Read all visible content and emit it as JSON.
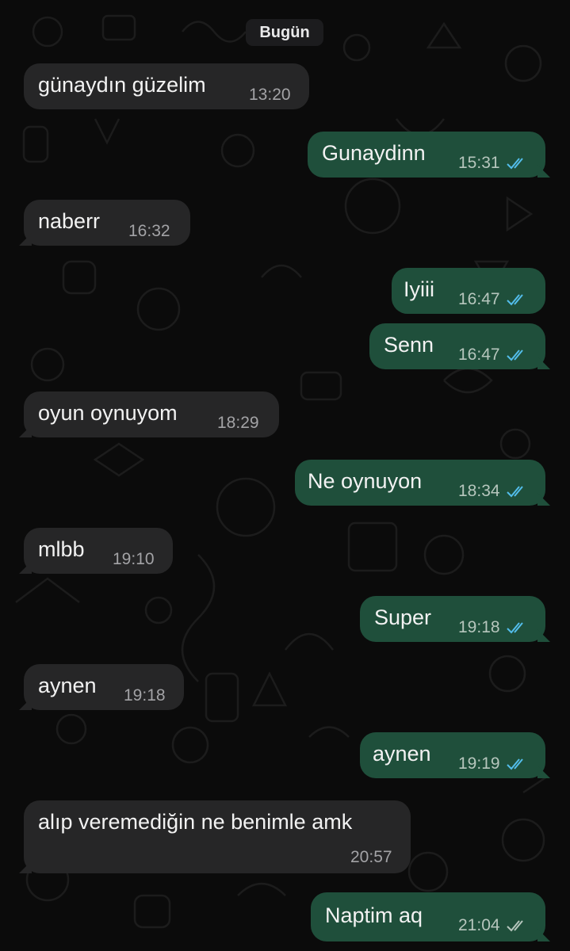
{
  "date_divider": "Bugün",
  "colors": {
    "background": "#0b0b0b",
    "incoming_bubble": "#262627",
    "outgoing_bubble": "#1f4f3b",
    "read_tick": "#53bdeb",
    "delivered_tick": "#b6c6bd"
  },
  "messages": [
    {
      "direction": "in",
      "text": "günaydın güzelim",
      "time": "13:20"
    },
    {
      "direction": "out",
      "text": "Gunaydinn",
      "time": "15:31",
      "status": "read"
    },
    {
      "direction": "in",
      "text": "naberr",
      "time": "16:32"
    },
    {
      "direction": "out",
      "text": "Iyiii",
      "time": "16:47",
      "status": "read"
    },
    {
      "direction": "out",
      "text": "Senn",
      "time": "16:47",
      "status": "read"
    },
    {
      "direction": "in",
      "text": "oyun oynuyom",
      "time": "18:29"
    },
    {
      "direction": "out",
      "text": "Ne oynuyon",
      "time": "18:34",
      "status": "read"
    },
    {
      "direction": "in",
      "text": "mlbb",
      "time": "19:10"
    },
    {
      "direction": "out",
      "text": "Super",
      "time": "19:18",
      "status": "read"
    },
    {
      "direction": "in",
      "text": "aynen",
      "time": "19:18"
    },
    {
      "direction": "out",
      "text": "aynen",
      "time": "19:19",
      "status": "read"
    },
    {
      "direction": "in",
      "text": "alıp veremediğin ne benimle amk",
      "time": "20:57"
    },
    {
      "direction": "out",
      "text": "Naptim aq",
      "time": "21:04",
      "status": "delivered"
    }
  ]
}
